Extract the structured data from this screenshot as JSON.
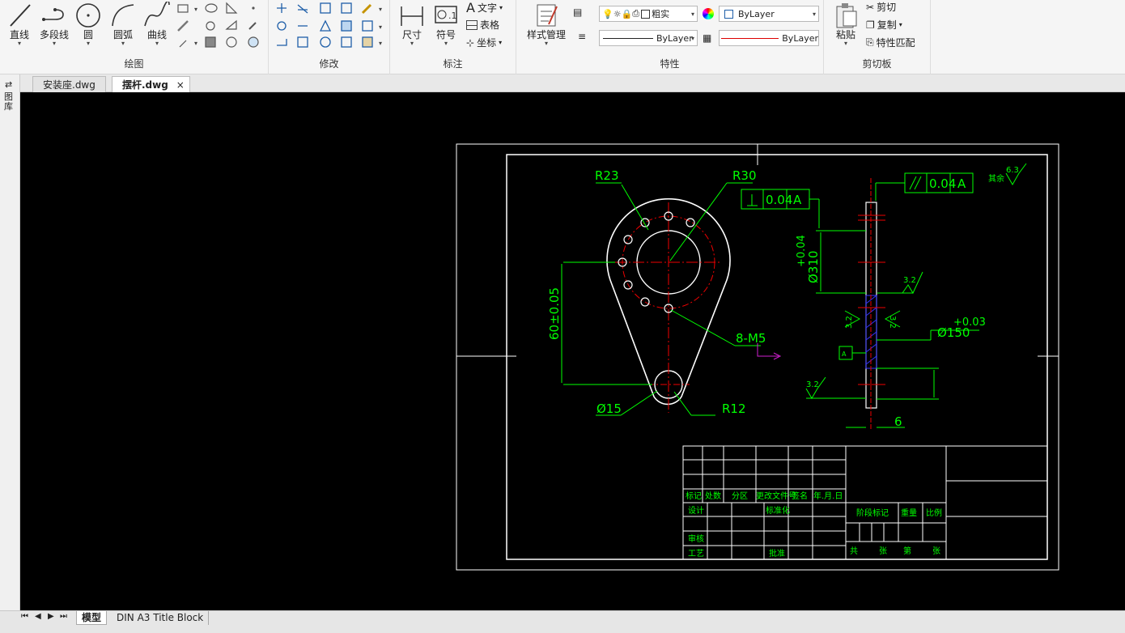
{
  "ribbon": {
    "draw": {
      "title": "绘图",
      "line": "直线",
      "polyline": "多段线",
      "circle": "圆",
      "arc": "圆弧",
      "curve": "曲线"
    },
    "modify": {
      "title": "修改"
    },
    "annotate": {
      "title": "标注",
      "dimension": "尺寸",
      "symbol": "符号",
      "text": "文字",
      "table": "表格",
      "coordinate": "坐标"
    },
    "properties": {
      "title": "特性",
      "style_manager": "样式管理",
      "layer_name": "粗实",
      "color": "ByLayer",
      "linetype": "ByLayer",
      "lineweight": "ByLayer"
    },
    "clipboard": {
      "title": "剪切板",
      "paste": "粘贴",
      "cut": "剪切",
      "copy": "复制",
      "match_props": "特性匹配"
    }
  },
  "doc_tabs": [
    {
      "label": "安装座.dwg",
      "active": false
    },
    {
      "label": "摆杆.dwg",
      "active": true
    }
  ],
  "sidebar_label": "图库",
  "layout_tabs": {
    "model": "模型",
    "layout1": "DIN A3 Title Block"
  },
  "drawing": {
    "dims": {
      "r23": "R23",
      "r30": "R30",
      "holes": "8-M5",
      "dist60": "60±0.05",
      "d15": "Ø15",
      "r12": "R12",
      "flat_tol": "0.04",
      "flat_ref": "A",
      "par_tol": "0.04",
      "par_ref": "A",
      "rough_other": "6.3",
      "rough_other_label": "其余",
      "rough1": "3.2",
      "rough2": "3.2",
      "rough3": "3.2",
      "rough4": "3.2",
      "d310": "Ø310",
      "d310_tol": "+0.04",
      "d150": "Ø150",
      "d150_tol": "+0.03",
      "thick": "6",
      "datum": "A"
    },
    "title_block": {
      "h1": "标记",
      "h2": "处数",
      "h3": "分区",
      "h4": "更改文件号",
      "h5": "签名",
      "h6": "年.月.日",
      "design": "设计",
      "standard": "标准化",
      "review": "审核",
      "process": "工艺",
      "approve": "批准",
      "stage": "阶段标记",
      "weight": "重量",
      "scale": "比例",
      "total": "共",
      "sheets": "张",
      "page": "第",
      "sheet2": "张"
    }
  }
}
